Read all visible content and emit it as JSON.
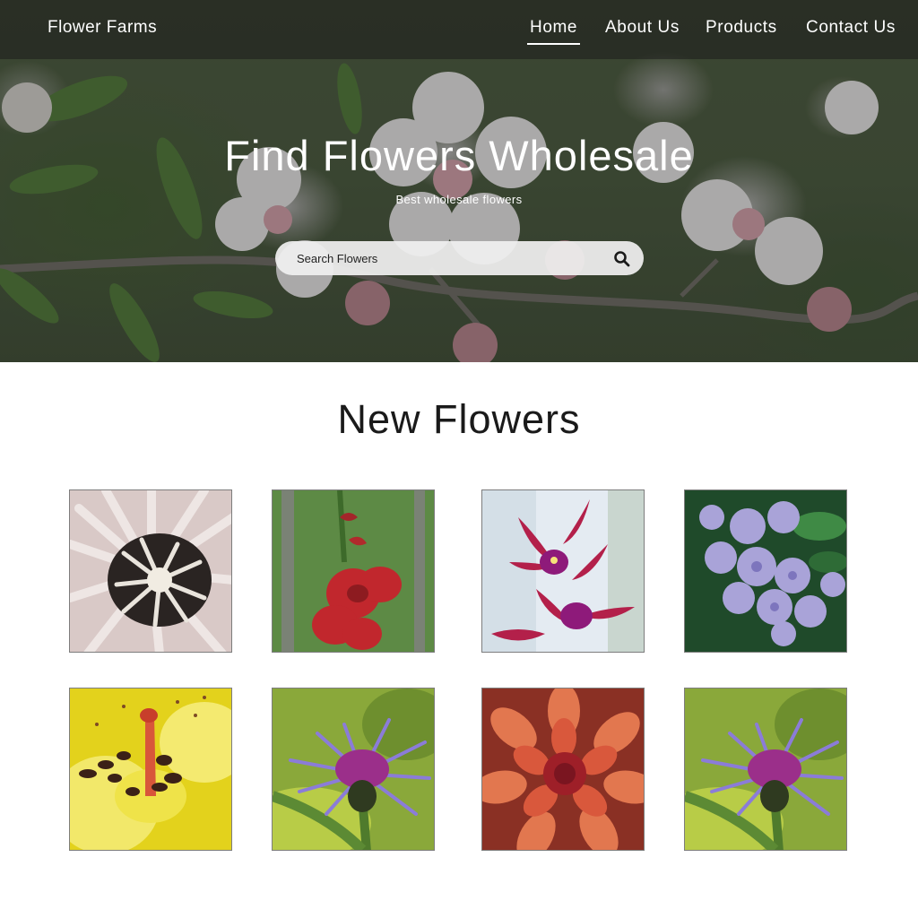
{
  "brand": "Flower Farms",
  "nav": {
    "items": [
      {
        "label": "Home",
        "active": true
      },
      {
        "label": "About Us",
        "active": false
      },
      {
        "label": "Products",
        "active": false
      },
      {
        "label": "Contact Us",
        "active": false
      }
    ]
  },
  "hero": {
    "title": "Find Flowers Wholesale",
    "subtitle": "Best wholesale flowers",
    "search": {
      "placeholder": "Search Flowers",
      "icon": "search-icon"
    }
  },
  "section": {
    "title": "New Flowers"
  },
  "flowers": [
    {
      "image": "sea-anemone-flower-image"
    },
    {
      "image": "red-gladiolus-image"
    },
    {
      "image": "pink-orchid-image"
    },
    {
      "image": "blue-bellflower-cluster-image"
    },
    {
      "image": "yellow-lily-closeup-image"
    },
    {
      "image": "purple-cornflower-image"
    },
    {
      "image": "orange-dahlia-image"
    },
    {
      "image": "purple-cornflower-image"
    }
  ],
  "colors": {
    "nav_bg": "#1c1c1c",
    "text_dark": "#1a1a1a",
    "search_bg": "#f0f0f0"
  }
}
